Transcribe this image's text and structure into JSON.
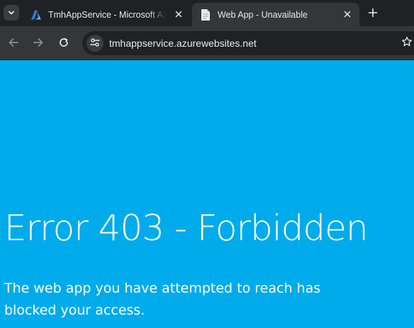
{
  "browser": {
    "tabs": [
      {
        "title": "TmhAppService - Microsoft Azure",
        "favicon": "azure-icon",
        "active": false
      },
      {
        "title": "Web App - Unavailable",
        "favicon": "document-icon",
        "active": true
      }
    ],
    "address_bar": {
      "url": "tmhappservice.azurewebsites.net"
    }
  },
  "page": {
    "error_title": "Error 403 - Forbidden",
    "error_message": "The web app you have attempted to reach has blocked your access."
  },
  "colors": {
    "page_background": "#00abec",
    "tab_strip": "#202124",
    "toolbar": "#35363a",
    "text": "#ffffff"
  }
}
